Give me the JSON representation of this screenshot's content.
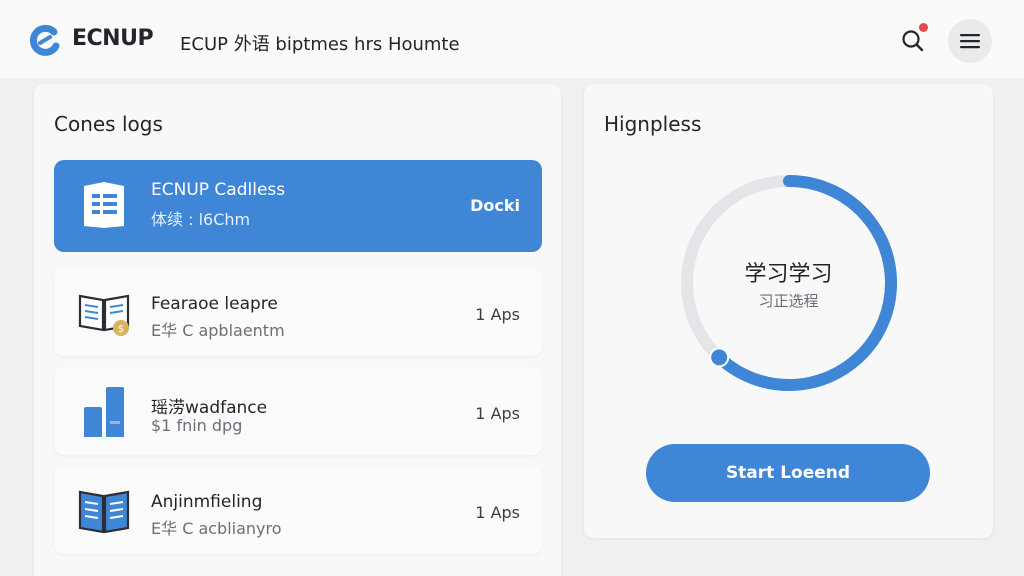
{
  "header": {
    "brand": "ECNUP",
    "title": "ECUP 外语 biptmes hrs Houmte"
  },
  "courses_panel": {
    "title": "Cones logs",
    "items": [
      {
        "name": "ECNUP Cadlless",
        "sub": "体续 : l6Chm",
        "meta": "Docki",
        "active": true
      },
      {
        "name": "Fearaoe leapre",
        "sub": "E华 C apblaentm",
        "meta": "1 Aps",
        "active": false
      },
      {
        "name": "瑶涝wadfance",
        "sub": "$1 fnin dpg",
        "meta": "1 Aps",
        "active": false
      },
      {
        "name": "Anjinmfieling",
        "sub": "E华 C acblianyro",
        "meta": "1 Aps",
        "active": false
      }
    ]
  },
  "progress_panel": {
    "title": "Hignpless",
    "ring_title": "学习学习",
    "ring_sub": "习正选程",
    "start_label": "Start Loeend",
    "progress": 0.62
  },
  "colors": {
    "accent": "#3f86d6",
    "notification": "#e5484d",
    "track": "#e3e5e8"
  }
}
